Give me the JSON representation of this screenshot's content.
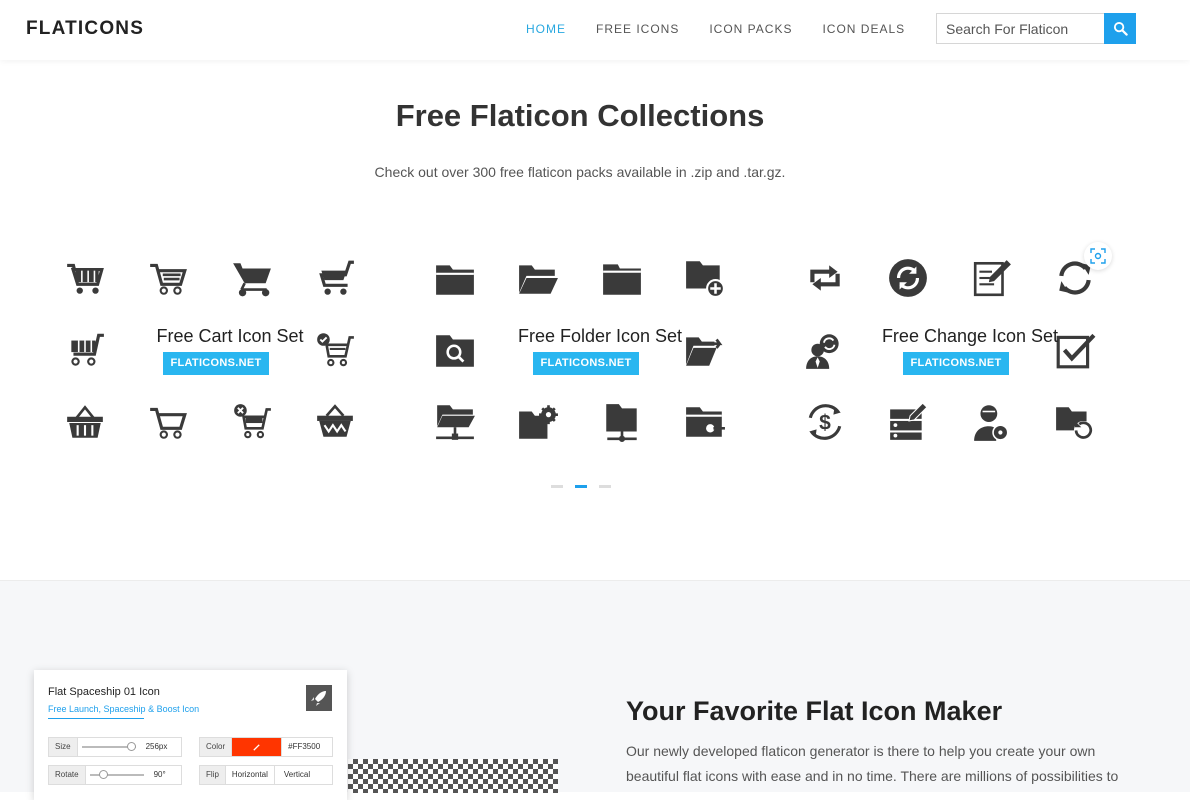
{
  "header": {
    "logo": "FLATICONS",
    "nav": [
      "HOME",
      "FREE ICONS",
      "ICON PACKS",
      "ICON DEALS"
    ],
    "active_nav": "HOME",
    "search_placeholder": "Search For Flaticon"
  },
  "hero": {
    "title": "Free Flaticon Collections",
    "subtitle": "Check out over 300 free flaticon packs available in .zip and .tar.gz."
  },
  "collections": [
    {
      "title": "Free Cart Icon Set",
      "badge": "FLATICONS.NET"
    },
    {
      "title": "Free Folder Icon Set",
      "badge": "FLATICONS.NET"
    },
    {
      "title": "Free Change Icon Set",
      "badge": "FLATICONS.NET"
    }
  ],
  "carousel": {
    "slides": 3,
    "active_index": 1
  },
  "editor": {
    "title": "Flat Spaceship 01 Icon",
    "subtitle": "Free Launch, Spaceship & Boost Icon",
    "size_label": "Size",
    "size_value": "256px",
    "color_label": "Color",
    "color_value": "#FF3500",
    "rotate_label": "Rotate",
    "rotate_value": "90°",
    "flip_label": "Flip",
    "flip_h": "Horizontal",
    "flip_v": "Vertical"
  },
  "maker": {
    "title": "Your Favorite Flat Icon Maker",
    "text": "Our newly developed flaticon generator is there to help you create your own beautiful flat icons with ease and in no time. There are millions of possibilities to"
  },
  "colors": {
    "accent": "#1ea0ec",
    "badge": "#29b6f0",
    "icon": "#3a3a3a",
    "swatch": "#FF3500"
  }
}
